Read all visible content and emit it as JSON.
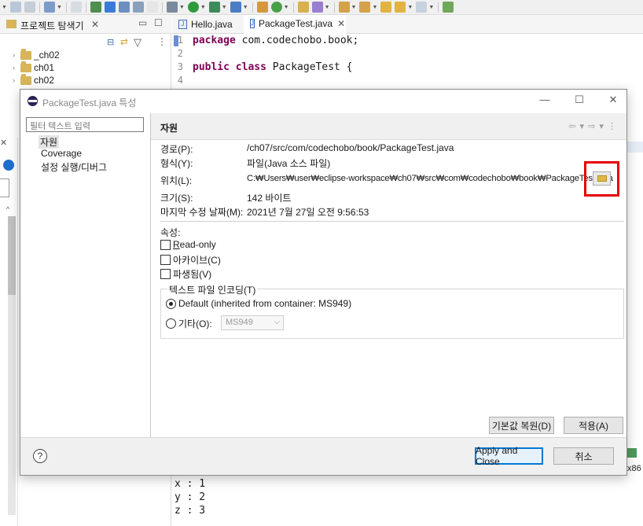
{
  "explorer": {
    "title": "프로젝트 탐색기",
    "items": [
      {
        "label": "_ch02"
      },
      {
        "label": "ch01"
      },
      {
        "label": "ch02"
      }
    ]
  },
  "editor": {
    "tabs": [
      {
        "label": "Hello.java",
        "active": false
      },
      {
        "label": "PackageTest.java",
        "active": true
      }
    ],
    "lines": [
      {
        "num": "1",
        "kw": "package",
        "rest": " com.codechobo.book;"
      },
      {
        "num": "2",
        "kw": "",
        "rest": ""
      },
      {
        "num": "3",
        "kw": "public class",
        "rest": " PackageTest {"
      },
      {
        "num": "4",
        "kw": "",
        "rest": ""
      }
    ]
  },
  "console": {
    "lines": [
      "x : 1",
      "y : 2",
      "z : 3"
    ]
  },
  "right_partial": "x86",
  "dialog": {
    "title": "PackageTest.java 특성",
    "filter_placeholder": "필터 텍스트 입력",
    "nav": [
      "자원",
      "Coverage",
      "설정 실행/디버그"
    ],
    "selected_nav": "자원",
    "pane_title": "자원",
    "info": {
      "path_label": "경로(P):",
      "path_value": "/ch07/src/com/codechobo/book/PackageTest.java",
      "type_label": "형식(Y):",
      "type_value": "파일(Java 소스 파일)",
      "location_label": "위치(L):",
      "location_value": "C:₩Users₩user₩eclipse-workspace₩ch07₩src₩com₩codechobo₩book₩PackageTest.java",
      "size_label": "크기(S):",
      "size_value": "142 바이트",
      "modified_label": "마지막 수정 날짜(M):",
      "modified_value": "2021년 7월 27일 오전 9:56:53"
    },
    "attributes_label": "속성:",
    "attributes": [
      {
        "label": "Read-only",
        "mnemonic": "R",
        "rest": "ead-only",
        "checked": false
      },
      {
        "label": "아카이브(C)",
        "checked": false
      },
      {
        "label": "파생됨(V)",
        "checked": false
      }
    ],
    "encoding": {
      "legend": "텍스트 파일 인코딩(T)",
      "default_label": "Default (inherited from container: MS949)",
      "other_label": "기타(O):",
      "other_value": "MS949",
      "selected": "default"
    },
    "buttons": {
      "restore_defaults": "기본값 복원(D)",
      "apply": "적용(A)",
      "apply_close": "Apply and Close",
      "cancel": "취소"
    },
    "highlight_color": "#e60000"
  }
}
